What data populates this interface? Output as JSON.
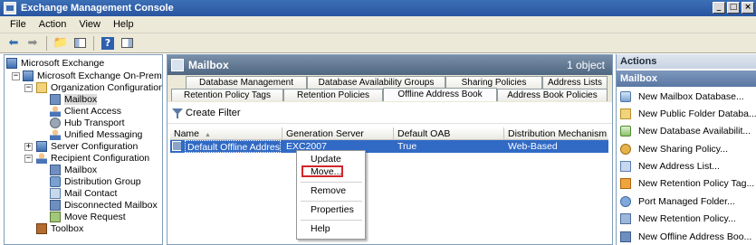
{
  "window": {
    "title": "Exchange Management Console",
    "controls": [
      "_",
      "□",
      "×"
    ]
  },
  "menu": [
    "File",
    "Action",
    "View",
    "Help"
  ],
  "tree": {
    "root": "Microsoft Exchange",
    "onprem": "Microsoft Exchange On-Premises (e",
    "org_config": "Organization Configuration",
    "org_mailbox": "Mailbox",
    "client_access": "Client Access",
    "hub_transport": "Hub Transport",
    "unified_messaging": "Unified Messaging",
    "server_config": "Server Configuration",
    "recipient_config": "Recipient Configuration",
    "rec_mailbox": "Mailbox",
    "distribution_group": "Distribution Group",
    "mail_contact": "Mail Contact",
    "disconnected_mailbox": "Disconnected Mailbox",
    "move_request": "Move Request",
    "toolbox": "Toolbox"
  },
  "center": {
    "title": "Mailbox",
    "count": "1 object",
    "tabs_row1": [
      "Database Management",
      "Database Availability Groups",
      "Sharing Policies",
      "Address Lists"
    ],
    "tabs_row2": [
      "Retention Policy Tags",
      "Retention Policies",
      "Offline Address Book",
      "Address Book Policies"
    ],
    "active_tab": "Offline Address Book",
    "create_filter": "Create Filter",
    "columns": [
      "Name",
      "Generation Server",
      "Default OAB",
      "Distribution Mechanism"
    ],
    "rows": [
      [
        "Default Offline Address...",
        "EXC2007",
        "True",
        "Web-Based"
      ]
    ]
  },
  "context_menu": {
    "items": [
      "Update",
      "Move...",
      "Remove",
      "Properties",
      "Help"
    ],
    "highlighted": "Move..."
  },
  "actions": {
    "header": "Actions",
    "section": "Mailbox",
    "items": [
      "New Mailbox Database...",
      "New Public Folder Databa...",
      "New Database Availabilit...",
      "New Sharing Policy...",
      "New Address List...",
      "New Retention Policy Tag...",
      "Port Managed Folder...",
      "New Retention Policy...",
      "New Offline Address Boo..."
    ]
  }
}
